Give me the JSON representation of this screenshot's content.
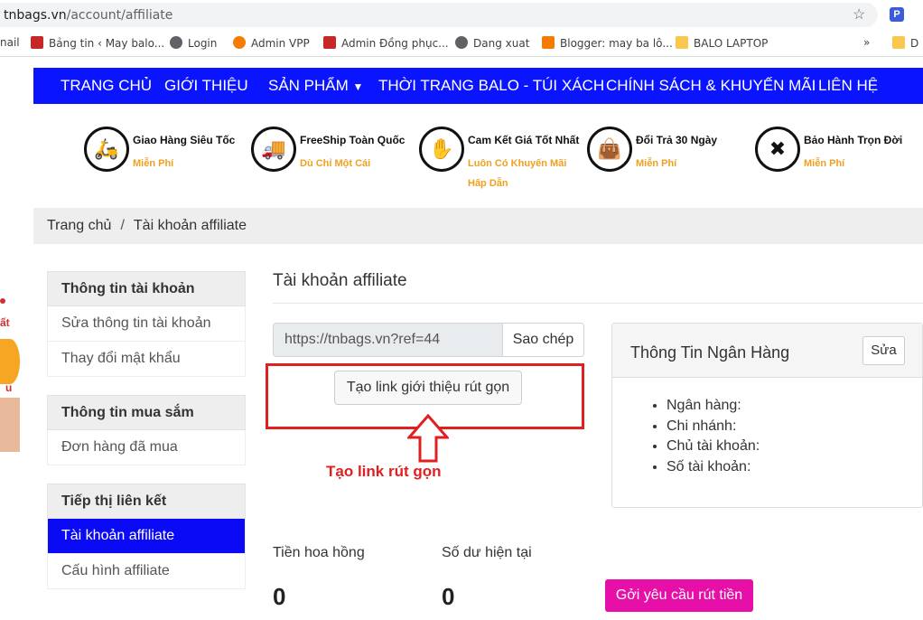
{
  "browser": {
    "url_host": "tnbags.vn",
    "url_path": "/account/affiliate",
    "bookmarks": [
      {
        "label": "nail",
        "color": "#ffffff"
      },
      {
        "label": "Bảng tin ‹ May balo...",
        "color": "#c62828"
      },
      {
        "label": "Login",
        "color": "#5f6368"
      },
      {
        "label": "Admin VPP",
        "color": "#f57c00"
      },
      {
        "label": "Admin Đồng phục...",
        "color": "#c62828"
      },
      {
        "label": "Dang xuat",
        "color": "#5f6368"
      },
      {
        "label": "Blogger: may ba lô...",
        "color": "#f57c00"
      },
      {
        "label": "BALO LAPTOP",
        "color": "#f9c74f"
      },
      {
        "label": "»",
        "color": "#ffffff"
      }
    ]
  },
  "nav": {
    "items": [
      "TRANG CHỦ",
      "GIỚI THIỆU",
      "SẢN PHẨM",
      "THỜI TRANG BALO - TÚI XÁCH",
      "CHÍNH SÁCH & KHUYẾN MÃI",
      "LIÊN HỆ"
    ],
    "color": "#0a14ff"
  },
  "features": [
    {
      "title": "Giao Hàng Siêu Tốc",
      "sub": "Miễn Phí",
      "icon": "delivery-scooter-icon"
    },
    {
      "title": "FreeShip Toàn Quốc",
      "sub": "Dù Chỉ Một Cái",
      "icon": "delivery-truck-icon"
    },
    {
      "title": "Cam Kết Giá Tốt Nhất",
      "sub": "Luôn Có Khuyến Mãi Hấp Dẫn",
      "icon": "price-hand-icon"
    },
    {
      "title": "Đổi Trả 30 Ngày",
      "sub": "Miễn Phí",
      "icon": "shopping-bag-icon"
    },
    {
      "title": "Bảo Hành Trọn Đời",
      "sub": "Miễn Phí",
      "icon": "tools-icon"
    }
  ],
  "breadcrumb": {
    "home": "Trang chủ",
    "sep": "/",
    "current": "Tài khoản affiliate"
  },
  "sidebar": {
    "groups": [
      {
        "head": "Thông tin tài khoản",
        "items": [
          "Sửa thông tin tài khoản",
          "Thay đổi mật khẩu"
        ]
      },
      {
        "head": "Thông tin mua sắm",
        "items": [
          "Đơn hàng đã mua"
        ]
      },
      {
        "head": "Tiếp thị liên kết",
        "items": [
          "Tài khoản affiliate",
          "Cấu hình affiliate"
        ]
      }
    ],
    "active": "Tài khoản affiliate"
  },
  "content": {
    "title": "Tài khoản affiliate",
    "ref_link": "https://tnbags.vn?ref=44",
    "copy_label": "Sao chép",
    "shorten_label": "Tạo link giới thiệu rút gọn",
    "annotation": "Tạo link rút gọn"
  },
  "bank": {
    "title": "Thông Tin Ngân Hàng",
    "edit_label": "Sửa",
    "fields": [
      "Ngân hàng:",
      "Chi nhánh:",
      "Chủ tài khoản:",
      "Số tài khoản:"
    ]
  },
  "stats": {
    "commission_label": "Tiền hoa hồng",
    "commission_value": "0",
    "balance_label": "Số dư hiện tại",
    "balance_value": "0",
    "withdraw_label": "Gởi yêu cầu rút tiền"
  },
  "left_banner": {
    "line1": "ất",
    "line2": "u"
  }
}
